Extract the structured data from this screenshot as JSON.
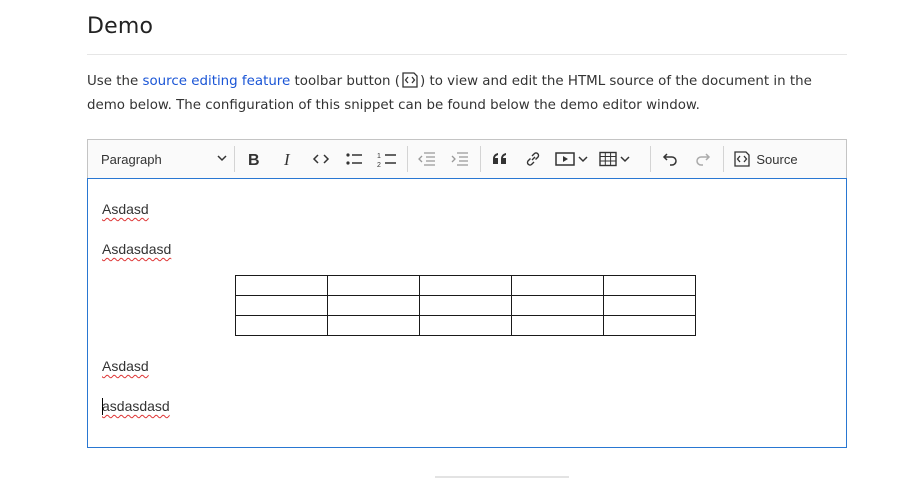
{
  "page": {
    "title": "Demo",
    "intro_prefix": "Use the ",
    "intro_link": "source editing feature",
    "intro_mid": " toolbar button (",
    "intro_suffix": ") to view and edit the HTML source of the document in the demo below. The configuration of this snippet can be found below the demo editor window."
  },
  "toolbar": {
    "heading_select": "Paragraph",
    "source_label": "Source",
    "icons": [
      "bold-icon",
      "italic-icon",
      "code-icon",
      "bulleted-list-icon",
      "numbered-list-icon",
      "outdent-icon",
      "indent-icon",
      "blockquote-icon",
      "link-icon",
      "media-icon",
      "table-icon",
      "undo-icon",
      "redo-icon",
      "source-icon"
    ]
  },
  "editor": {
    "paragraphs": [
      "Asdasd",
      "Asdasdasd",
      "Asdasd",
      "asdasdasd"
    ],
    "table": {
      "rows": 3,
      "cols": 5
    }
  },
  "colors": {
    "link": "#1a55d6",
    "focus_border": "#2977d2",
    "spell_underline": "#dd3333"
  }
}
